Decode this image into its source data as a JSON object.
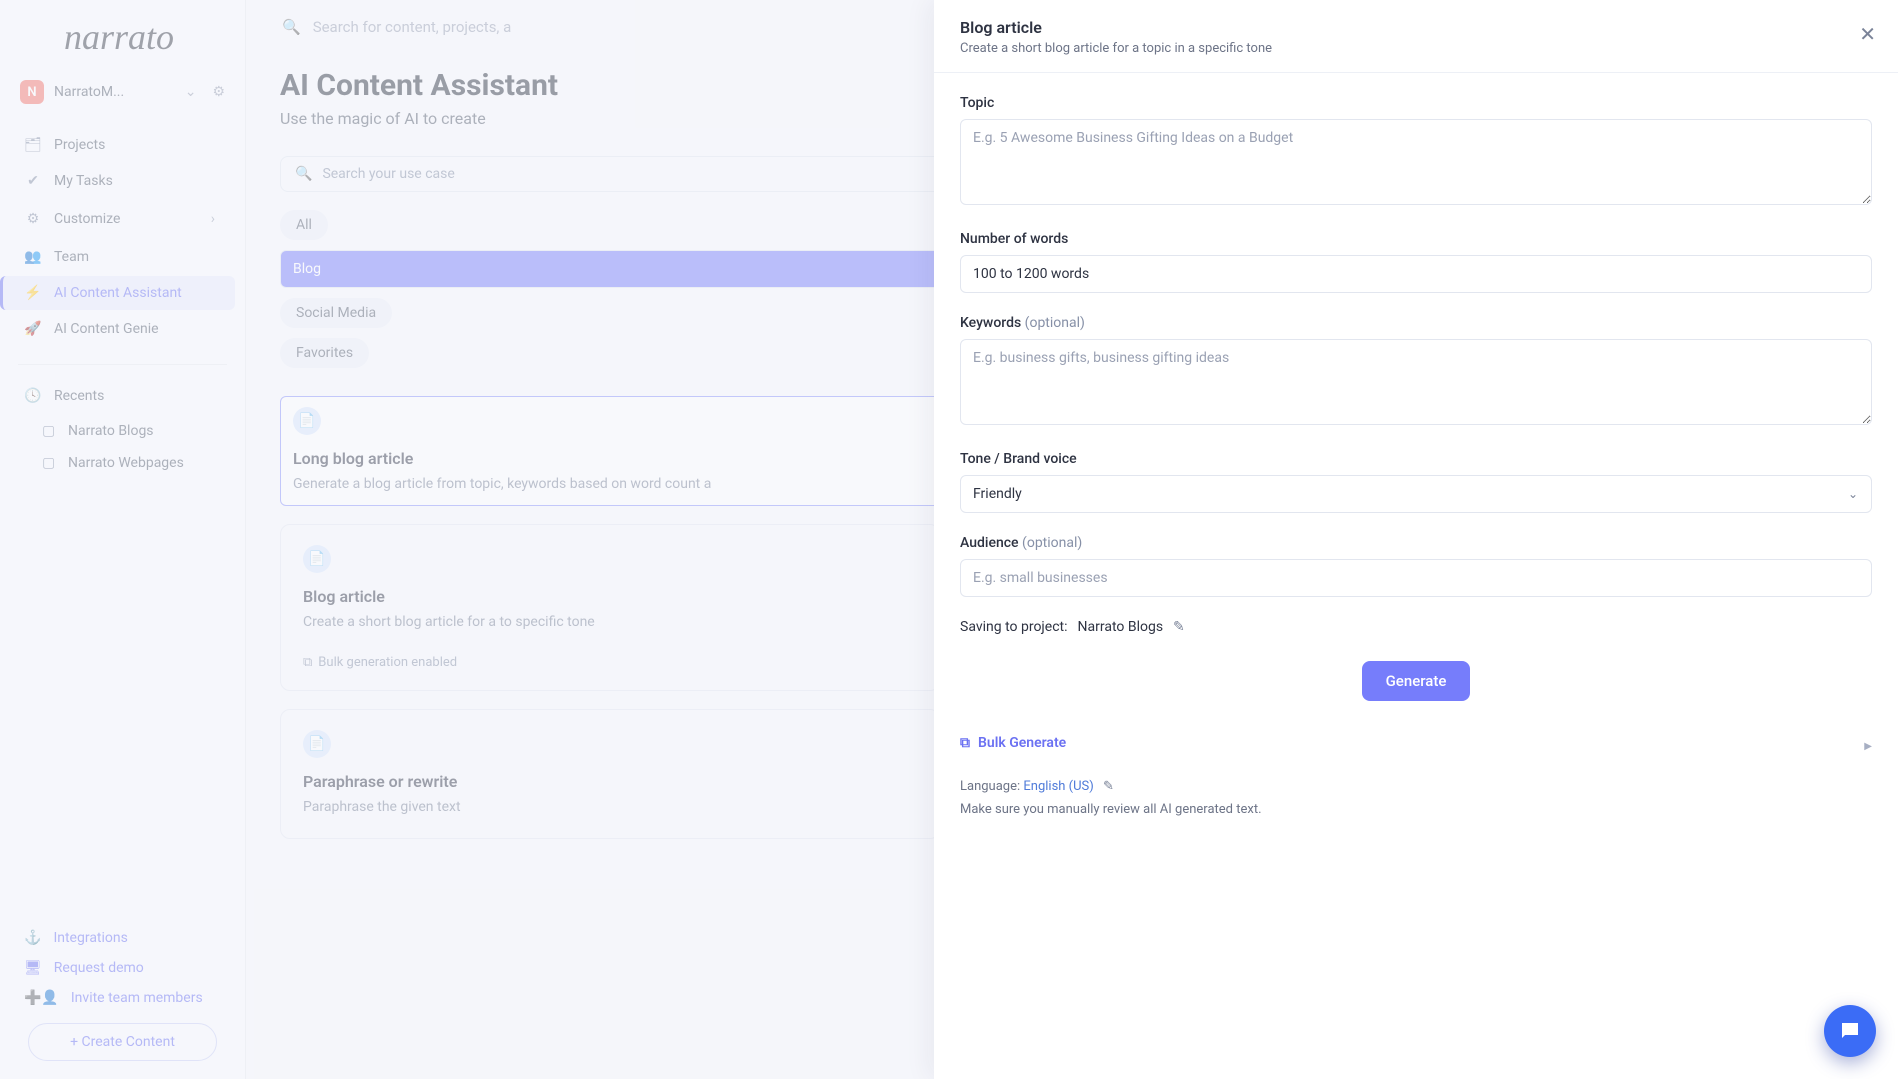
{
  "brand": "narrato",
  "workspace": {
    "initial": "N",
    "name": "NarratoM..."
  },
  "sidebar": {
    "items": [
      {
        "icon": "folder",
        "label": "Projects"
      },
      {
        "icon": "check",
        "label": "My Tasks"
      },
      {
        "icon": "gear",
        "label": "Customize"
      },
      {
        "icon": "team",
        "label": "Team"
      },
      {
        "icon": "bolt",
        "label": "AI Content Assistant",
        "active": true
      },
      {
        "icon": "rocket",
        "label": "AI Content Genie"
      }
    ],
    "recents_label": "Recents",
    "recents": [
      "Narrato Blogs",
      "Narrato Webpages"
    ],
    "bottom": [
      {
        "icon": "anchor",
        "label": "Integrations"
      },
      {
        "icon": "monitor",
        "label": "Request demo"
      },
      {
        "icon": "adduser",
        "label": "Invite team members"
      }
    ],
    "create": "+ Create Content"
  },
  "main": {
    "search_placeholder": "Search for content, projects, a",
    "title": "AI Content Assistant",
    "subtitle": "Use the magic of AI to create",
    "usecase_placeholder": "Search your use case",
    "chips": [
      "All",
      "Blog",
      "Social Media",
      "Favorites"
    ],
    "chip_selected": 1,
    "cards": [
      {
        "title": "Long blog article",
        "desc": "Generate a blog article from topic, keywords based on word count a",
        "selected": true,
        "bulk": false
      },
      {
        "title": "Blog article",
        "desc": "Create a short blog article for a to specific tone",
        "selected": false,
        "bulk": true,
        "bulk_label": "Bulk generation enabled"
      },
      {
        "title": "Paraphrase or rewrite",
        "desc": "Paraphrase the given text",
        "selected": false,
        "bulk": false
      }
    ]
  },
  "panel": {
    "title": "Blog article",
    "subtitle": "Create a short blog article for a topic in a specific tone",
    "fields": {
      "topic": {
        "label": "Topic",
        "placeholder": "E.g. 5 Awesome Business Gifting Ideas on a Budget"
      },
      "words": {
        "label": "Number of words",
        "value": "100 to 1200 words"
      },
      "keywords": {
        "label": "Keywords",
        "optional": "(optional)",
        "placeholder": "E.g. business gifts, business gifting ideas"
      },
      "tone": {
        "label": "Tone / Brand voice",
        "value": "Friendly"
      },
      "audience": {
        "label": "Audience",
        "optional": "(optional)",
        "placeholder": "E.g. small businesses"
      }
    },
    "save_label": "Saving to project:",
    "save_project": "Narrato Blogs",
    "generate": "Generate",
    "bulk": "Bulk Generate",
    "language_label": "Language:",
    "language_value": "English (US)",
    "disclaimer": "Make sure you manually review all AI generated text."
  }
}
